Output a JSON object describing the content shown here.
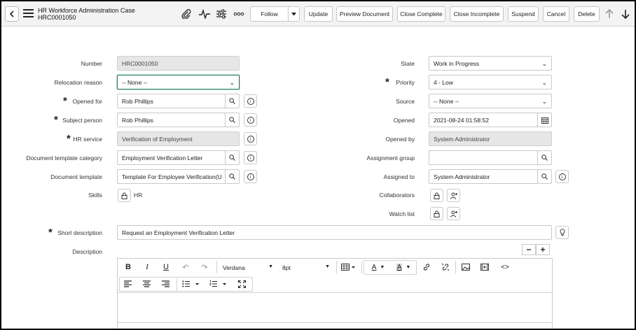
{
  "header": {
    "title": "HR Workforce Administration Case",
    "number": "HRC0001050",
    "buttons": {
      "follow": "Follow",
      "update": "Update",
      "preview": "Preview Document",
      "close_complete": "Close Complete",
      "close_incomplete": "Close Incomplete",
      "suspend": "Suspend",
      "cancel": "Cancel",
      "delete": "Delete"
    }
  },
  "form": {
    "left": {
      "number": {
        "label": "Number",
        "value": "HRC0001050"
      },
      "relocation_reason": {
        "label": "Relocation reason",
        "value": "-- None --"
      },
      "opened_for": {
        "label": "Opened for",
        "value": "Rob Phillips"
      },
      "subject_person": {
        "label": "Subject person",
        "value": "Rob Phillips"
      },
      "hr_service": {
        "label": "HR service",
        "value": "Verification of Employment"
      },
      "doc_template_category": {
        "label": "Document template category",
        "value": "Employment Verification Letter"
      },
      "doc_template": {
        "label": "Document template",
        "value": "Template For Employee Verification(U"
      },
      "skills": {
        "label": "Skills",
        "value": "HR"
      }
    },
    "right": {
      "state": {
        "label": "State",
        "value": "Work in Progress"
      },
      "priority": {
        "label": "Priority",
        "value": "4 - Low"
      },
      "source": {
        "label": "Source",
        "value": "-- None --"
      },
      "opened": {
        "label": "Opened",
        "value": "2021-08-24 01:58:52"
      },
      "opened_by": {
        "label": "Opened by",
        "value": "System Administrator"
      },
      "assignment_group": {
        "label": "Assignment group",
        "value": ""
      },
      "assigned_to": {
        "label": "Assigned to",
        "value": "System Administrator"
      },
      "collaborators": {
        "label": "Collaborators"
      },
      "watch_list": {
        "label": "Watch list"
      }
    },
    "short_description": {
      "label": "Short description",
      "value": "Request an Employment Verification Letter"
    },
    "description": {
      "label": "Description"
    }
  },
  "editor": {
    "font": "Verdana",
    "size": "8pt"
  },
  "icons": [
    "back-icon",
    "menu-icon",
    "paperclip-icon",
    "activity-icon",
    "sliders-icon",
    "more-icon",
    "caret-down-icon",
    "arrow-up-icon",
    "arrow-down-icon",
    "search-icon",
    "info-icon",
    "calendar-icon",
    "lock-icon",
    "add-user-icon",
    "lightbulb-icon"
  ]
}
